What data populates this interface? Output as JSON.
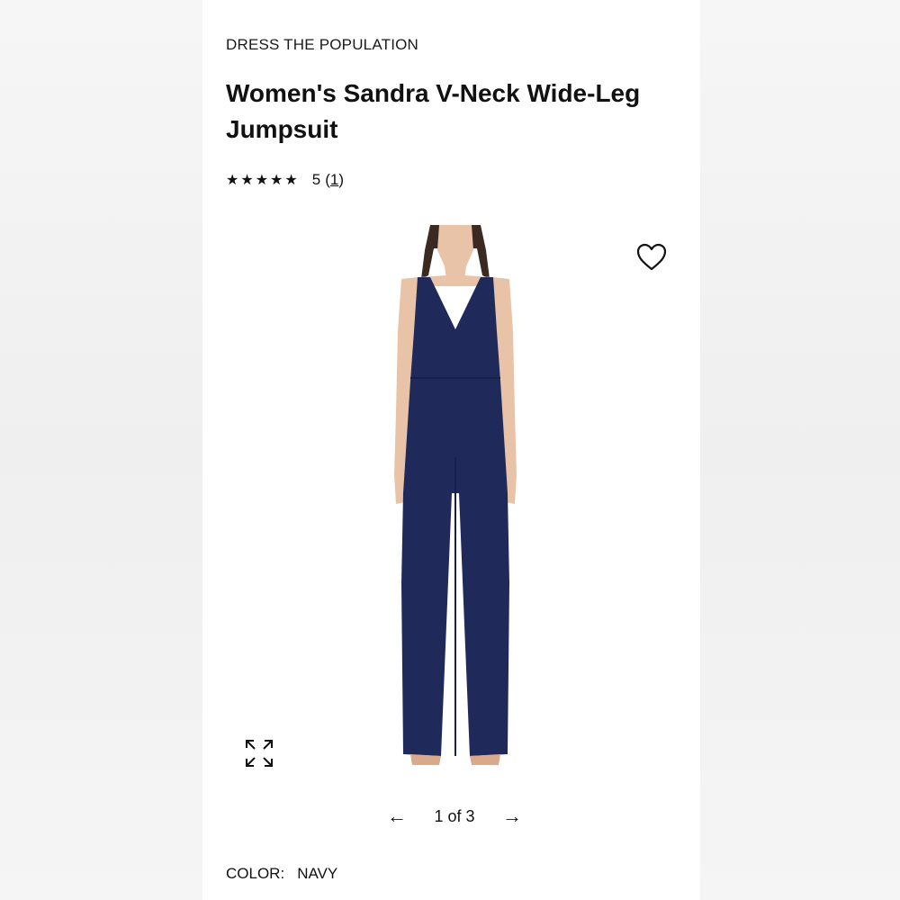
{
  "product": {
    "brand": "DRESS THE POPULATION",
    "title": "Women's Sandra V-Neck Wide-Leg Jumpsuit",
    "rating": {
      "stars": "★★★★★",
      "score": "5",
      "count_open": "(",
      "count": "1",
      "count_close": ")"
    },
    "colors": {
      "garment": "#1f2a5a",
      "skin": "#e9c3a8",
      "hair": "#3a2a22"
    }
  },
  "gallery": {
    "wishlist_icon": "heart-outline-icon",
    "expand_icon": "expand-arrows-icon",
    "prev_arrow": "←",
    "next_arrow": "→",
    "position": "1 of 3"
  },
  "color_selector": {
    "label": "COLOR:",
    "value": "NAVY"
  }
}
